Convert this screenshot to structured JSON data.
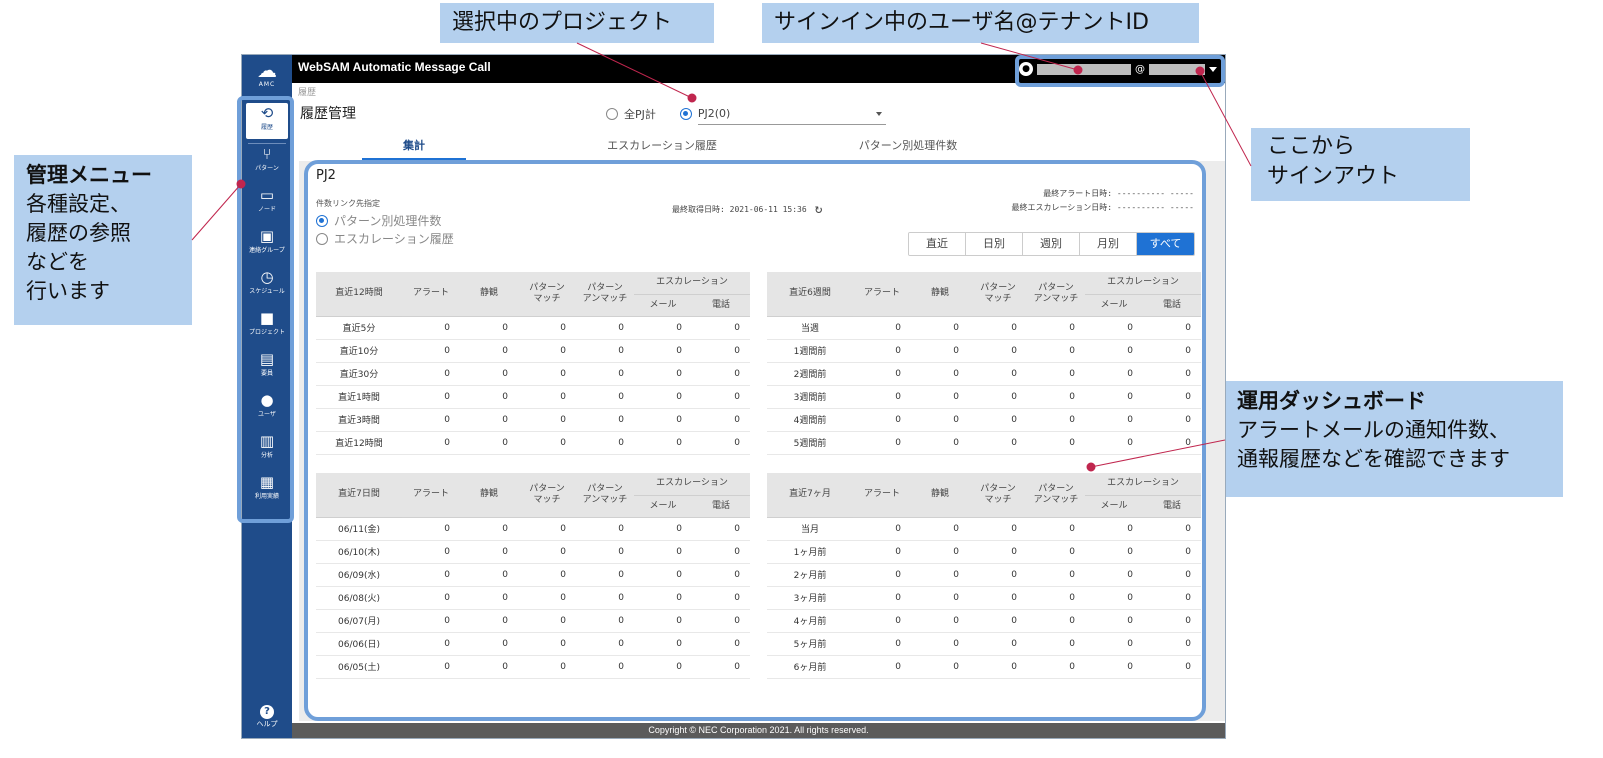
{
  "callouts": {
    "project": "選択中のプロジェクト",
    "user": "サインイン中のユーザ名@テナントID",
    "signout": [
      "ここから",
      "サインアウト"
    ],
    "menu": {
      "title": "管理メニュー",
      "lines": [
        "各種設定、",
        "履歴の参照",
        "などを",
        "行います"
      ]
    },
    "dashboard": {
      "title": "運用ダッシュボード",
      "lines": [
        "アラートメールの通知件数、",
        "通報履歴などを確認できます"
      ]
    }
  },
  "colors": {
    "sidebar": "#1f4c8a",
    "accent": "#1f72d4",
    "callout": "#b4d0ee",
    "frame": "#6f9fd9",
    "marker": "#c0264e"
  },
  "app": {
    "logo": {
      "icon": "cloud-icon",
      "text": "AMC"
    },
    "title": "WebSAM Automatic Message Call",
    "user": {
      "icon": "user-icon",
      "at": "@"
    },
    "breadcrumb": "履歴",
    "page_title": "履歴管理",
    "project_select": {
      "all_label": "全PJ計",
      "selected": "PJ2(0)"
    },
    "tabs": [
      "集計",
      "エスカレーション履歴",
      "パターン別処理件数"
    ],
    "nav": [
      {
        "label": "履歴",
        "icon": "history-icon",
        "glyph": "⟲"
      },
      {
        "label": "パターン",
        "icon": "pattern-icon",
        "glyph": "⑂"
      },
      {
        "label": "ノード",
        "icon": "monitor-icon",
        "glyph": "▭"
      },
      {
        "label": "連絡グループ",
        "icon": "contact-group-icon",
        "glyph": "▣"
      },
      {
        "label": "スケジュール",
        "icon": "clock-icon",
        "glyph": "◷"
      },
      {
        "label": "プロジェクト",
        "icon": "briefcase-icon",
        "glyph": "■"
      },
      {
        "label": "要員",
        "icon": "id-card-icon",
        "glyph": "▤"
      },
      {
        "label": "ユーザ",
        "icon": "person-icon",
        "glyph": "●"
      },
      {
        "label": "分析",
        "icon": "bar-chart-icon",
        "glyph": "▥"
      },
      {
        "label": "利用実績",
        "icon": "calendar-icon",
        "glyph": "▦"
      }
    ],
    "help": {
      "icon": "help-icon",
      "glyph": "?",
      "label": "ヘルプ"
    },
    "footer": "Copyright © NEC Corporation 2021. All rights reserved."
  },
  "dashboard": {
    "project_name": "PJ2",
    "link_title": "件数リンク先指定",
    "link_options": [
      {
        "label": "パターン別処理件数",
        "selected": true
      },
      {
        "label": "エスカレーション履歴",
        "selected": false
      }
    ],
    "last_fetch": "最終取得日時: 2021-06-11 15:36",
    "last_alert": "最終アラート日時: ---------- -----",
    "last_escalation": "最終エスカレーション日時: ---------- -----",
    "periods": [
      "直近",
      "日別",
      "週別",
      "月別",
      "すべて"
    ],
    "active_period": "すべて",
    "columns": {
      "alert": "アラート",
      "silence": "静観",
      "match": [
        "パターン",
        "マッチ"
      ],
      "unmatch": [
        "パターン",
        "アンマッチ"
      ],
      "escalation": "エスカレーション",
      "mail": "メール",
      "phone": "電話"
    },
    "tables": [
      {
        "header": "直近12時間",
        "rows": [
          [
            "直近5分",
            0,
            0,
            0,
            0,
            0,
            0
          ],
          [
            "直近10分",
            0,
            0,
            0,
            0,
            0,
            0
          ],
          [
            "直近30分",
            0,
            0,
            0,
            0,
            0,
            0
          ],
          [
            "直近1時間",
            0,
            0,
            0,
            0,
            0,
            0
          ],
          [
            "直近3時間",
            0,
            0,
            0,
            0,
            0,
            0
          ],
          [
            "直近12時間",
            0,
            0,
            0,
            0,
            0,
            0
          ]
        ]
      },
      {
        "header": "直近6週間",
        "rows": [
          [
            "当週",
            0,
            0,
            0,
            0,
            0,
            0
          ],
          [
            "1週間前",
            0,
            0,
            0,
            0,
            0,
            0
          ],
          [
            "2週間前",
            0,
            0,
            0,
            0,
            0,
            0
          ],
          [
            "3週間前",
            0,
            0,
            0,
            0,
            0,
            0
          ],
          [
            "4週間前",
            0,
            0,
            0,
            0,
            0,
            0
          ],
          [
            "5週間前",
            0,
            0,
            0,
            0,
            0,
            0
          ]
        ]
      },
      {
        "header": "直近7日間",
        "rows": [
          [
            "06/11(金)",
            0,
            0,
            0,
            0,
            0,
            0
          ],
          [
            "06/10(木)",
            0,
            0,
            0,
            0,
            0,
            0
          ],
          [
            "06/09(水)",
            0,
            0,
            0,
            0,
            0,
            0
          ],
          [
            "06/08(火)",
            0,
            0,
            0,
            0,
            0,
            0
          ],
          [
            "06/07(月)",
            0,
            0,
            0,
            0,
            0,
            0
          ],
          [
            "06/06(日)",
            0,
            0,
            0,
            0,
            0,
            0
          ],
          [
            "06/05(土)",
            0,
            0,
            0,
            0,
            0,
            0
          ]
        ]
      },
      {
        "header": "直近7ヶ月",
        "rows": [
          [
            "当月",
            0,
            0,
            0,
            0,
            0,
            0
          ],
          [
            "1ヶ月前",
            0,
            0,
            0,
            0,
            0,
            0
          ],
          [
            "2ヶ月前",
            0,
            0,
            0,
            0,
            0,
            0
          ],
          [
            "3ヶ月前",
            0,
            0,
            0,
            0,
            0,
            0
          ],
          [
            "4ヶ月前",
            0,
            0,
            0,
            0,
            0,
            0
          ],
          [
            "5ヶ月前",
            0,
            0,
            0,
            0,
            0,
            0
          ],
          [
            "6ヶ月前",
            0,
            0,
            0,
            0,
            0,
            0
          ]
        ]
      }
    ]
  }
}
